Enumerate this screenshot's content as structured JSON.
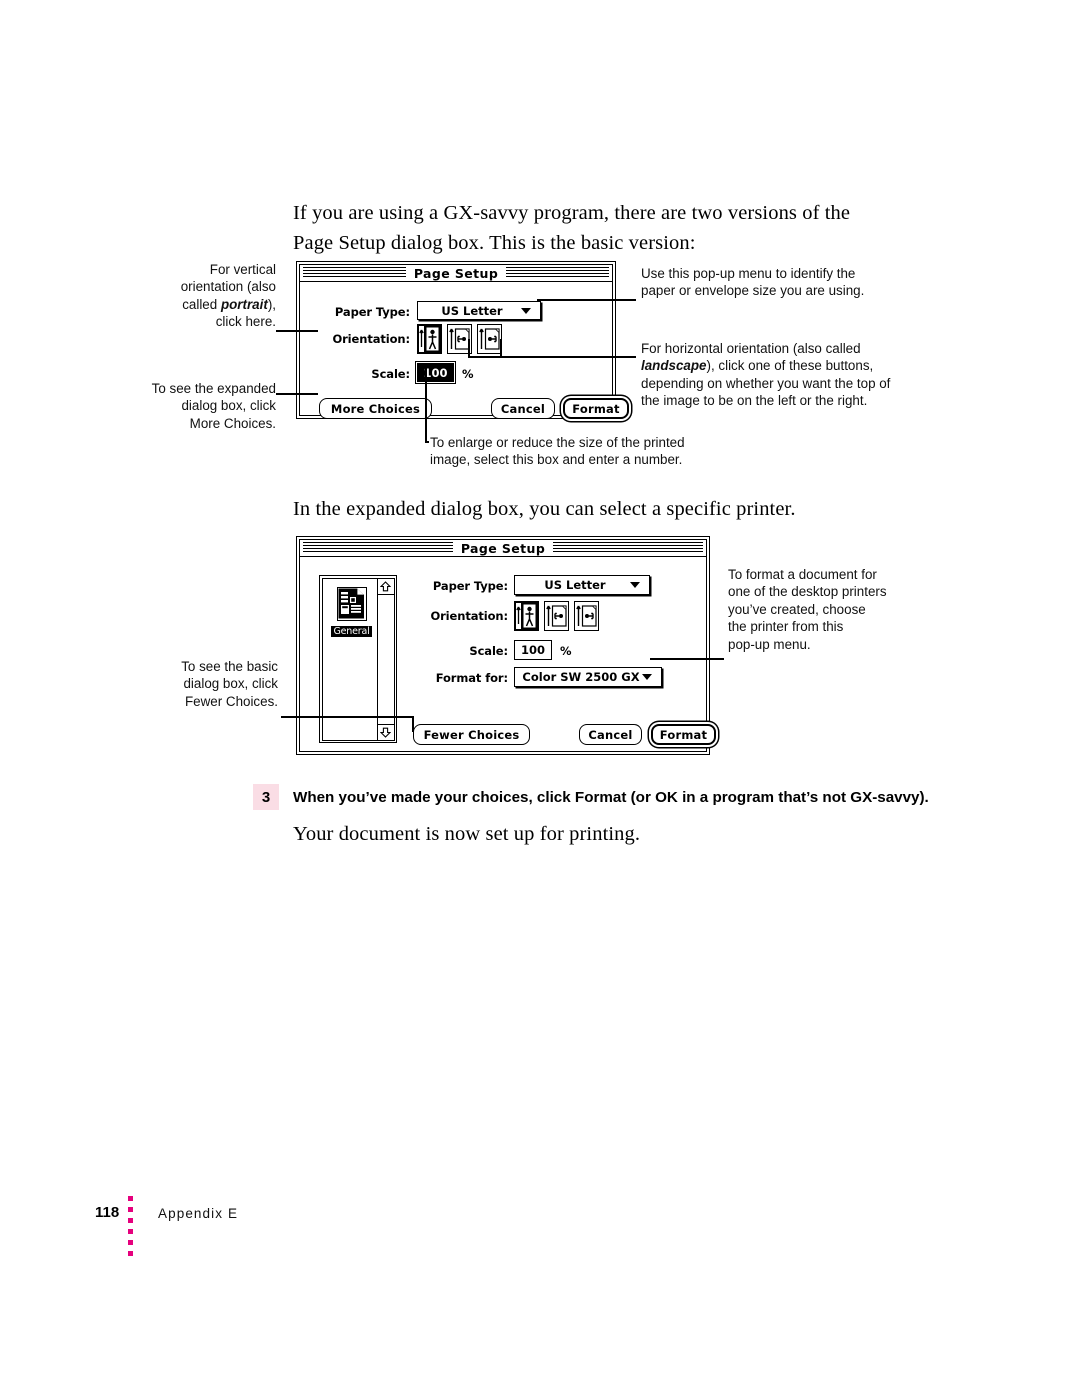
{
  "page": {
    "intro_paragraph": "If you are using a GX-savvy program, there are two versions of the Page Setup dialog box. This is the basic version:",
    "expanded_paragraph": "In the expanded dialog box, you can select a specific printer.",
    "closing_paragraph": "Your document is now set up for printing."
  },
  "basic_dialog": {
    "title": "Page Setup",
    "paper_type_label": "Paper Type:",
    "paper_type_value": "US Letter",
    "orientation_label": "Orientation:",
    "orientation_options": [
      "portrait-icon",
      "landscape-left-icon",
      "landscape-right-icon"
    ],
    "orientation_selected": 0,
    "scale_label": "Scale:",
    "scale_value": "100",
    "scale_unit": "%",
    "more_choices_label": "More Choices",
    "cancel_label": "Cancel",
    "format_label": "Format"
  },
  "expanded_dialog": {
    "title": "Page Setup",
    "printer_item_name": "General",
    "paper_type_label": "Paper Type:",
    "paper_type_value": "US Letter",
    "orientation_label": "Orientation:",
    "orientation_selected": 0,
    "scale_label": "Scale:",
    "scale_value": "100",
    "scale_unit": "%",
    "format_for_label": "Format for:",
    "format_for_value": "Color SW 2500 GX",
    "fewer_choices_label": "Fewer Choices",
    "cancel_label": "Cancel",
    "format_label": "Format",
    "scroll_up_icon": "scroll-up-arrow-icon",
    "scroll_down_icon": "scroll-down-arrow-icon"
  },
  "callouts": {
    "vertical_orientation_l1": "For vertical",
    "vertical_orientation_l2": "orientation (also",
    "vertical_orientation_l3_a": "called ",
    "vertical_orientation_l3_i": "portrait",
    "vertical_orientation_l3_b": "),",
    "vertical_orientation_l4": "click here.",
    "more_choices_l1": "To see the expanded",
    "more_choices_l2": "dialog box, click",
    "more_choices_l3": "More Choices.",
    "popup_menu_l1": "Use this pop-up menu to identify the",
    "popup_menu_l2": "paper or envelope size you are using.",
    "landscape_l1": "For horizontal orientation (also called",
    "landscape_l2_i": "landscape",
    "landscape_l2_b": "), click one of these buttons,",
    "landscape_l3": "depending on  whether you want the top of",
    "landscape_l4": "the image to be on the left or the right.",
    "scale_l1": "To enlarge or reduce the size of the printed",
    "scale_l2": "image, select this box and enter a number.",
    "fewer_choices_l1": "To see the basic",
    "fewer_choices_l2": "dialog box, click",
    "fewer_choices_l3": "Fewer Choices.",
    "format_for_l1": "To format a document for",
    "format_for_l2": "one of the desktop printers",
    "format_for_l3": "you’ve created, choose",
    "format_for_l4": "the printer from this",
    "format_for_l5": "pop-up menu."
  },
  "step": {
    "number": "3",
    "number_bg": "#fadde5",
    "text": "When you’ve made your choices, click Format (or OK in a program that’s not GX-savvy)."
  },
  "footer": {
    "page_number": "118",
    "section_label": "Appendix E",
    "rule_color": "#e5007d"
  }
}
